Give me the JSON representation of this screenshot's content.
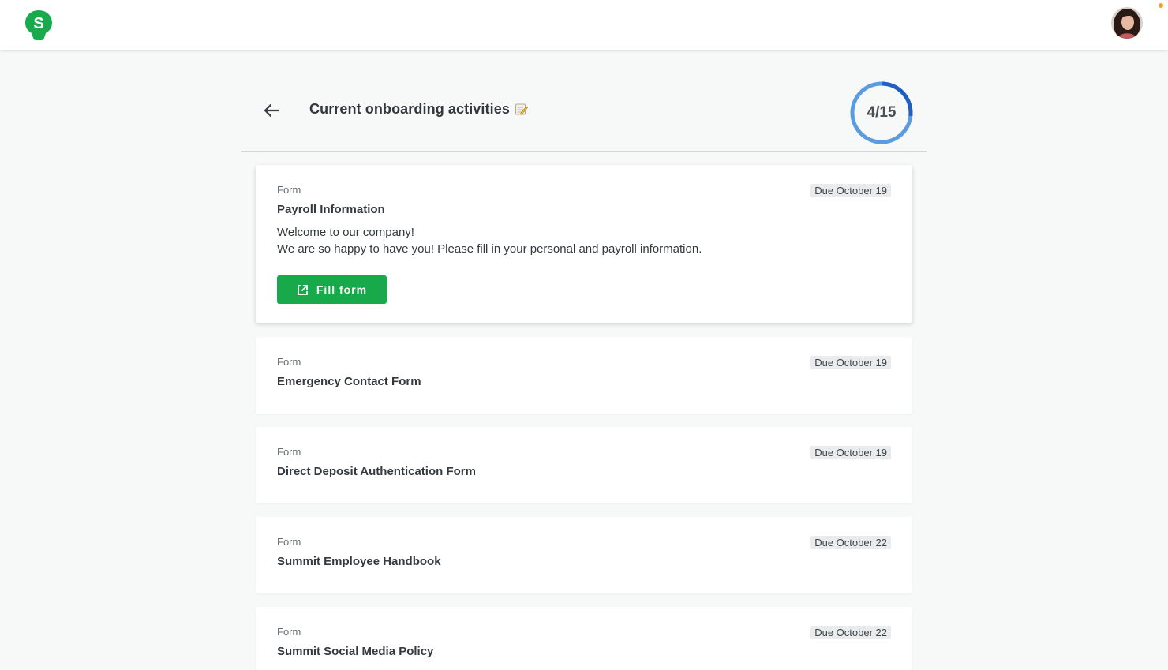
{
  "header": {
    "title": "Current onboarding activities",
    "progress": {
      "label": "4/15",
      "completed": 4,
      "total": 15
    }
  },
  "colors": {
    "brand_green": "#17a94a",
    "progress_track": "#5b9be0",
    "progress_fill": "#1f5fc0"
  },
  "icons": {
    "logo": "bulb-s-logo-icon",
    "back": "arrow-left-icon",
    "title_emoji": "memo-icon",
    "button": "external-link-icon"
  },
  "activities": [
    {
      "type": "Form",
      "title": "Payroll Information",
      "due": "Due October 19",
      "description_line1": "Welcome to our company!",
      "description_line2": "We are so happy to have you! Please fill in your personal and payroll information.",
      "button_label": "Fill form"
    },
    {
      "type": "Form",
      "title": "Emergency Contact Form",
      "due": "Due October 19"
    },
    {
      "type": "Form",
      "title": "Direct Deposit Authentication Form",
      "due": "Due October 19"
    },
    {
      "type": "Form",
      "title": "Summit Employee Handbook",
      "due": "Due October 22"
    },
    {
      "type": "Form",
      "title": "Summit Social Media Policy",
      "due": "Due October 22"
    }
  ]
}
